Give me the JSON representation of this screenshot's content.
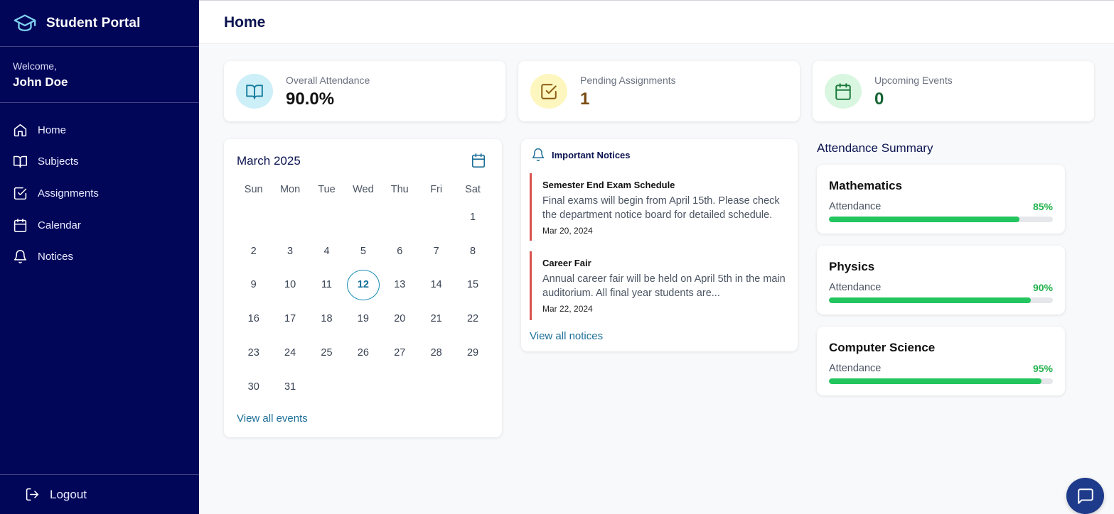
{
  "sidebar": {
    "brand": "Student Portal",
    "welcome_label": "Welcome,",
    "user_name": "John Doe",
    "items": [
      {
        "label": "Home",
        "icon": "home-icon"
      },
      {
        "label": "Subjects",
        "icon": "book-icon"
      },
      {
        "label": "Assignments",
        "icon": "check-square-icon"
      },
      {
        "label": "Calendar",
        "icon": "calendar-icon"
      },
      {
        "label": "Notices",
        "icon": "bell-icon"
      }
    ],
    "logout_label": "Logout"
  },
  "header": {
    "title": "Home"
  },
  "stats": [
    {
      "label": "Overall Attendance",
      "value": "90.0%",
      "icon": "book-icon",
      "icon_bg": "#cdeff7",
      "icon_color": "#1a7fa0",
      "value_color": "#111111"
    },
    {
      "label": "Pending Assignments",
      "value": "1",
      "icon": "check-square-icon",
      "icon_bg": "#fdf6bf",
      "icon_color": "#8a5a12",
      "value_color": "#7a4a10"
    },
    {
      "label": "Upcoming Events",
      "value": "0",
      "icon": "calendar-icon",
      "icon_bg": "#d9f6e0",
      "icon_color": "#1a7a3a",
      "value_color": "#166534"
    }
  ],
  "calendar": {
    "title": "March 2025",
    "weekdays": [
      "Sun",
      "Mon",
      "Tue",
      "Wed",
      "Thu",
      "Fri",
      "Sat"
    ],
    "days": [
      "",
      "",
      "",
      "",
      "",
      "",
      "1",
      "2",
      "3",
      "4",
      "5",
      "6",
      "7",
      "8",
      "9",
      "10",
      "11",
      "12",
      "13",
      "14",
      "15",
      "16",
      "17",
      "18",
      "19",
      "20",
      "21",
      "22",
      "23",
      "24",
      "25",
      "26",
      "27",
      "28",
      "29",
      "30",
      "31"
    ],
    "today": "12",
    "link": "View all events"
  },
  "notices": {
    "title": "Important Notices",
    "items": [
      {
        "title": "Semester End Exam Schedule",
        "body": "Final exams will begin from April 15th. Please check the department notice board for detailed schedule.",
        "date": "Mar 20, 2024"
      },
      {
        "title": "Career Fair",
        "body": "Annual career fair will be held on April 5th in the main auditorium. All final year students are...",
        "date": "Mar 22, 2024"
      }
    ],
    "link": "View all notices"
  },
  "attendance": {
    "title": "Attendance Summary",
    "subjects": [
      {
        "name": "Mathematics",
        "label": "Attendance",
        "percent": 85,
        "percent_label": "85%"
      },
      {
        "name": "Physics",
        "label": "Attendance",
        "percent": 90,
        "percent_label": "90%"
      },
      {
        "name": "Computer Science",
        "label": "Attendance",
        "percent": 95,
        "percent_label": "95%"
      }
    ]
  },
  "colors": {
    "sidebar_bg": "#020659",
    "accent_link": "#1d6f98",
    "progress": "#22c55e",
    "notice_border": "#d9534f"
  }
}
